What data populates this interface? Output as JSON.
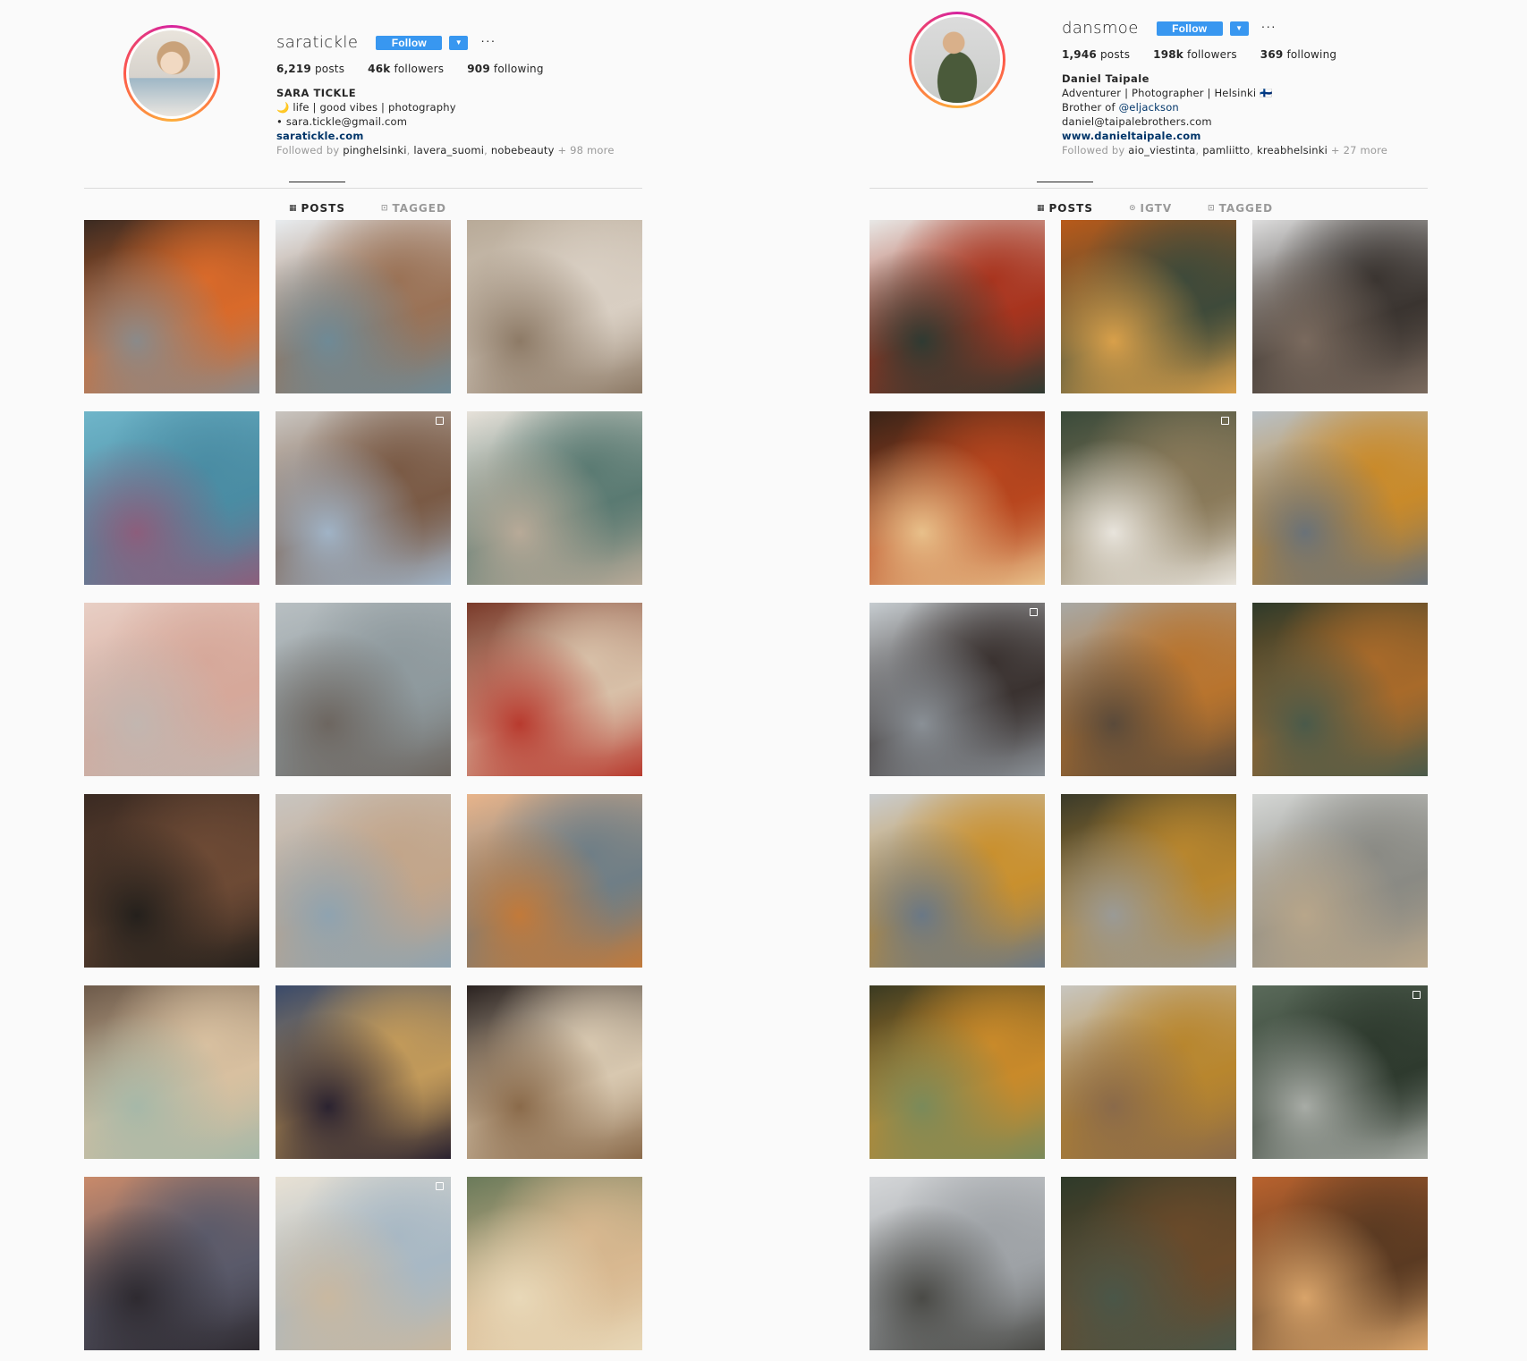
{
  "profiles": [
    {
      "username": "saratickle",
      "follow_label": "Follow",
      "dropdown_icon": "caret-down-icon",
      "more_label": "···",
      "stats": {
        "posts": "6,219",
        "posts_label": "posts",
        "followers": "46k",
        "followers_label": "followers",
        "following": "909",
        "following_label": "following"
      },
      "bio": {
        "name": "SARA TICKLE",
        "lines": [
          "🌙 life | good vibes | photography",
          "• sara.tickle@gmail.com"
        ],
        "link": "saratickle.com"
      },
      "followed_by": {
        "prefix": "Followed by",
        "users": [
          "pinghelsinki",
          "lavera_suomi",
          "nobebeauty"
        ],
        "more": "+ 98 more"
      },
      "tabs": [
        {
          "label": "POSTS",
          "icon": "grid-icon",
          "active": true
        },
        {
          "label": "TAGGED",
          "icon": "tag-icon",
          "active": false
        }
      ],
      "posts": [
        {
          "colors": [
            "#3a2a22",
            "#d96a2a",
            "#8a8a8a"
          ],
          "desc": "fireplace",
          "multi": false
        },
        {
          "colors": [
            "#e8ecef",
            "#9a7256",
            "#6f8a96"
          ],
          "desc": "coffee bottles",
          "multi": false
        },
        {
          "colors": [
            "#b8aa98",
            "#d9cfc3",
            "#8d7a66"
          ],
          "desc": "bed",
          "multi": false
        },
        {
          "colors": [
            "#6fb5c9",
            "#4a8ca3",
            "#8c5e7c"
          ],
          "desc": "lake",
          "multi": false
        },
        {
          "colors": [
            "#c9c5c0",
            "#7a5a45",
            "#a0b3c6"
          ],
          "desc": "flatlay",
          "multi": true
        },
        {
          "colors": [
            "#e6e1d9",
            "#5a7a72",
            "#b8aa98"
          ],
          "desc": "portrait",
          "multi": false
        },
        {
          "colors": [
            "#e8cfc5",
            "#d6a89a",
            "#c2b6b0"
          ],
          "desc": "sky",
          "multi": false
        },
        {
          "colors": [
            "#b8bfc2",
            "#8e999d",
            "#6d6660"
          ],
          "desc": "dock",
          "multi": false
        },
        {
          "colors": [
            "#7a3a2a",
            "#d8c0a8",
            "#b83a2e"
          ],
          "desc": "christmas",
          "multi": false
        },
        {
          "colors": [
            "#3a2a22",
            "#6d4a35",
            "#24201c"
          ],
          "desc": "cafe",
          "multi": false
        },
        {
          "colors": [
            "#c9c5c0",
            "#c2a58a",
            "#8fa3b0"
          ],
          "desc": "window",
          "multi": false
        },
        {
          "colors": [
            "#e8b48a",
            "#6f7e86",
            "#c27a3a"
          ],
          "desc": "bridge",
          "multi": false
        },
        {
          "colors": [
            "#6d5a4a",
            "#d8c0a0",
            "#a6b8a8"
          ],
          "desc": "tea",
          "multi": false
        },
        {
          "colors": [
            "#3a4a6a",
            "#c29a5a",
            "#2a2230"
          ],
          "desc": "city night",
          "multi": false
        },
        {
          "colors": [
            "#2a2220",
            "#d8c8b0",
            "#8a6a4a"
          ],
          "desc": "patisserie",
          "multi": false
        },
        {
          "colors": [
            "#c98a6a",
            "#5a5a6a",
            "#2e2a30"
          ],
          "desc": "sunset dock",
          "multi": false
        },
        {
          "colors": [
            "#e8e1d4",
            "#a8b8c4",
            "#c9b8a0"
          ],
          "desc": "bastion",
          "multi": true
        },
        {
          "colors": [
            "#6a7a5a",
            "#d8b890",
            "#e8d8b8"
          ],
          "desc": "tram",
          "multi": false
        }
      ]
    },
    {
      "username": "dansmoe",
      "follow_label": "Follow",
      "dropdown_icon": "caret-down-icon",
      "more_label": "···",
      "stats": {
        "posts": "1,946",
        "posts_label": "posts",
        "followers": "198k",
        "followers_label": "followers",
        "following": "369",
        "following_label": "following"
      },
      "bio": {
        "name": "Daniel Taipale",
        "line1": "Adventurer | Photographer | Helsinki 🇫🇮",
        "brother_prefix": "Brother of",
        "brother_mention": "@eljackson",
        "email": "daniel@taipalebrothers.com",
        "link": "www.danieltaipale.com"
      },
      "followed_by": {
        "prefix": "Followed by",
        "users": [
          "aio_viestinta",
          "pamliitto",
          "kreabhelsinki"
        ],
        "more": "+ 27 more"
      },
      "tabs": [
        {
          "label": "POSTS",
          "icon": "grid-icon",
          "active": true
        },
        {
          "label": "IGTV",
          "icon": "igtv-icon",
          "active": false
        },
        {
          "label": "TAGGED",
          "icon": "tag-icon",
          "active": false
        }
      ],
      "posts": [
        {
          "colors": [
            "#e8e8e6",
            "#a8341e",
            "#2f3a32"
          ],
          "desc": "temple autumn",
          "multi": false
        },
        {
          "colors": [
            "#b85a1a",
            "#3e4a3a",
            "#d9a04a"
          ],
          "desc": "boat",
          "multi": false
        },
        {
          "colors": [
            "#dcdcdc",
            "#3a3430",
            "#7a6a5e"
          ],
          "desc": "kyoto street",
          "multi": false
        },
        {
          "colors": [
            "#3a2418",
            "#b8461e",
            "#e8c08a"
          ],
          "desc": "autumn tree",
          "multi": false
        },
        {
          "colors": [
            "#3a4a3a",
            "#8a7a5a",
            "#e8e4dc"
          ],
          "desc": "shop",
          "multi": true
        },
        {
          "colors": [
            "#b8c0c6",
            "#c98a2a",
            "#6a7278"
          ],
          "desc": "mountain reflection",
          "multi": false
        },
        {
          "colors": [
            "#c6ccd0",
            "#3a3230",
            "#8a9096"
          ],
          "desc": "cabin",
          "multi": true
        },
        {
          "colors": [
            "#a8a8a4",
            "#b8742e",
            "#5a4a3a"
          ],
          "desc": "valley",
          "multi": false
        },
        {
          "colors": [
            "#2e3a2a",
            "#a86a2a",
            "#4a5a4a"
          ],
          "desc": "forest lake",
          "multi": false
        },
        {
          "colors": [
            "#c9ccce",
            "#c9902e",
            "#6a7886"
          ],
          "desc": "mountain lake",
          "multi": false
        },
        {
          "colors": [
            "#3a3a2a",
            "#b8862e",
            "#9a9a96"
          ],
          "desc": "roots",
          "multi": false
        },
        {
          "colors": [
            "#d4d6d4",
            "#8a8a84",
            "#b8a68a"
          ],
          "desc": "rocky valley",
          "multi": false
        },
        {
          "colors": [
            "#3a3a22",
            "#c98a2a",
            "#7a8a5a"
          ],
          "desc": "deer",
          "multi": false
        },
        {
          "colors": [
            "#c8c6c0",
            "#b8862e",
            "#8a6a4a"
          ],
          "desc": "lake cliffs",
          "multi": false
        },
        {
          "colors": [
            "#5a6a5a",
            "#2e3a2e",
            "#a8aca6"
          ],
          "desc": "mug forest",
          "multi": true
        },
        {
          "colors": [
            "#d4d6d8",
            "#9ea2a6",
            "#4a4a46"
          ],
          "desc": "misty lake",
          "multi": false
        },
        {
          "colors": [
            "#2e3a2a",
            "#6a4a2a",
            "#4a5648"
          ],
          "desc": "forest cabin",
          "multi": false
        },
        {
          "colors": [
            "#b8622e",
            "#5a3a22",
            "#d9a46a"
          ],
          "desc": "spiral tower",
          "multi": false
        }
      ]
    }
  ]
}
